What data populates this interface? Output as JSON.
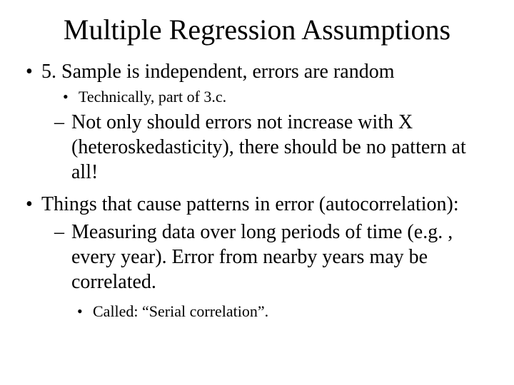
{
  "title": "Multiple Regression Assumptions",
  "items": {
    "p1": "5.  Sample is independent, errors are random",
    "p1a": "Technically, part of 3.c.",
    "p1b": "Not only should errors not increase with X (heteroskedasticity), there should be no pattern at all!",
    "p2": "Things that cause patterns in error (autocorrelation):",
    "p2a": "Measuring data over long periods of time (e.g. , every year).  Error from nearby years may be correlated.",
    "p2a1": "Called:  “Serial correlation”."
  }
}
